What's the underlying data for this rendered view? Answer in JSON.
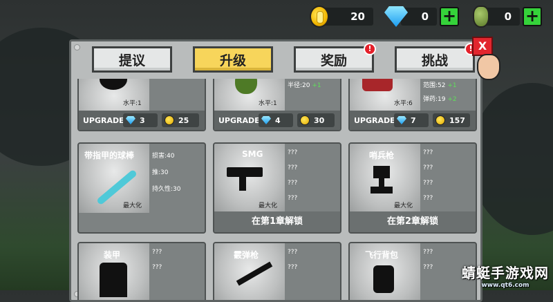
{
  "currencies": {
    "coins": "20",
    "gems": "0",
    "grenades": "0"
  },
  "tabs": [
    {
      "label": "提议",
      "active": false,
      "alert": false
    },
    {
      "label": "升级",
      "active": true,
      "alert": false
    },
    {
      "label": "奖励",
      "active": false,
      "alert": true
    },
    {
      "label": "挑战",
      "active": false,
      "alert": true
    }
  ],
  "alert_mark": "!",
  "close_label": "X",
  "top_cards": [
    {
      "level": "水平:1",
      "stats": [],
      "upgrade_label": "UPGRADE:",
      "gem_cost": "3",
      "coin_cost": "25"
    },
    {
      "level": "水平:1",
      "stats": [
        {
          "label": "半径:20",
          "plus": "+1"
        }
      ],
      "upgrade_label": "UPGRADE:",
      "gem_cost": "4",
      "coin_cost": "30"
    },
    {
      "level": "水平:6",
      "stats": [
        {
          "label": "范围:52",
          "plus": "+1"
        },
        {
          "label": "弹药:19",
          "plus": "+2"
        }
      ],
      "upgrade_label": "UPGRADE:",
      "gem_cost": "7",
      "coin_cost": "157"
    }
  ],
  "mid_cards": [
    {
      "title": "带指甲的球棒",
      "stats": [
        "损害:40",
        "推:30",
        "持久性:30"
      ],
      "level": "最大化",
      "unlock": ""
    },
    {
      "title": "SMG",
      "stats": [
        "???",
        "???",
        "???",
        "???"
      ],
      "level": "最大化",
      "unlock": "在第1章解锁"
    },
    {
      "title": "哨兵枪",
      "stats": [
        "???",
        "???",
        "???",
        "???"
      ],
      "level": "最大化",
      "unlock": "在第2章解锁"
    }
  ],
  "bottom_cards": [
    {
      "title": "装甲",
      "stats": [
        "???",
        "???"
      ]
    },
    {
      "title": "霰弹枪",
      "stats": [
        "???",
        "???"
      ]
    },
    {
      "title": "飞行背包",
      "stats": [
        "???",
        "???"
      ]
    }
  ],
  "watermark": {
    "title": "蜻蜓手游戏网",
    "url": "www.qt6.com"
  }
}
